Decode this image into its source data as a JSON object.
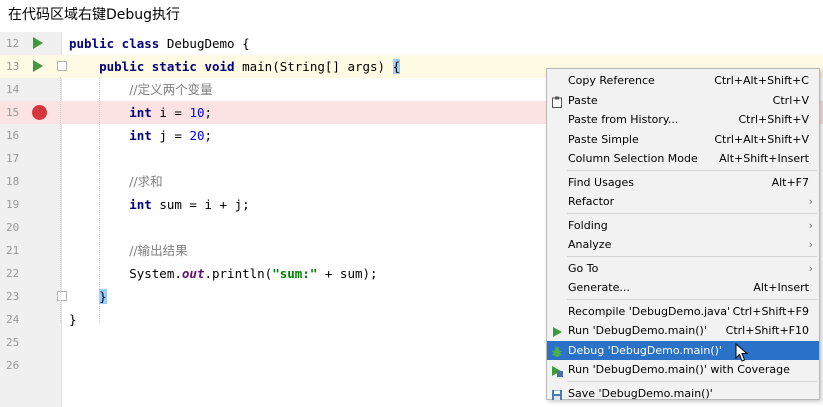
{
  "caption": "在代码区域右键Debug执行",
  "editor": {
    "lines": [
      {
        "num": "12",
        "code": [
          {
            "t": "public class ",
            "c": "kw"
          },
          {
            "t": "DebugDemo {",
            "c": ""
          }
        ]
      },
      {
        "num": "13",
        "code": [
          {
            "t": "    public static void ",
            "c": "kw"
          },
          {
            "t": "main(String[] args) ",
            "c": ""
          },
          {
            "t": "{",
            "c": "brace-hl"
          }
        ]
      },
      {
        "num": "14",
        "code": [
          {
            "t": "        ",
            "c": ""
          },
          {
            "t": "//定义两个变量",
            "c": "cmt"
          }
        ]
      },
      {
        "num": "15",
        "code": [
          {
            "t": "        ",
            "c": ""
          },
          {
            "t": "int ",
            "c": "kw"
          },
          {
            "t": "i = ",
            "c": ""
          },
          {
            "t": "10",
            "c": "num"
          },
          {
            "t": ";",
            "c": ""
          }
        ]
      },
      {
        "num": "16",
        "code": [
          {
            "t": "        ",
            "c": ""
          },
          {
            "t": "int ",
            "c": "kw"
          },
          {
            "t": "j = ",
            "c": ""
          },
          {
            "t": "20",
            "c": "num"
          },
          {
            "t": ";",
            "c": ""
          }
        ]
      },
      {
        "num": "17",
        "code": []
      },
      {
        "num": "18",
        "code": [
          {
            "t": "        ",
            "c": ""
          },
          {
            "t": "//求和",
            "c": "cmt"
          }
        ]
      },
      {
        "num": "19",
        "code": [
          {
            "t": "        ",
            "c": ""
          },
          {
            "t": "int ",
            "c": "kw"
          },
          {
            "t": "sum = i + j;",
            "c": ""
          }
        ]
      },
      {
        "num": "20",
        "code": []
      },
      {
        "num": "21",
        "code": [
          {
            "t": "        ",
            "c": ""
          },
          {
            "t": "//输出结果",
            "c": "cmt"
          }
        ]
      },
      {
        "num": "22",
        "code": [
          {
            "t": "        System.",
            "c": ""
          },
          {
            "t": "out",
            "c": "stat"
          },
          {
            "t": ".println(",
            "c": ""
          },
          {
            "t": "\"sum:\"",
            "c": "str"
          },
          {
            "t": " + sum);",
            "c": ""
          }
        ]
      },
      {
        "num": "23",
        "code": [
          {
            "t": "    ",
            "c": ""
          },
          {
            "t": "}",
            "c": "brace-hl"
          }
        ]
      },
      {
        "num": "24",
        "code": [
          {
            "t": "}",
            "c": ""
          }
        ]
      },
      {
        "num": "25",
        "code": []
      },
      {
        "num": "26",
        "code": []
      }
    ]
  },
  "menu": {
    "items": [
      {
        "label": "Copy Reference",
        "shortcut": "Ctrl+Alt+Shift+C"
      },
      {
        "label": "Paste",
        "shortcut": "Ctrl+V",
        "icon": "clipboard-icon"
      },
      {
        "label": "Paste from History...",
        "shortcut": "Ctrl+Shift+V"
      },
      {
        "label": "Paste Simple",
        "shortcut": "Ctrl+Alt+Shift+V"
      },
      {
        "label": "Column Selection Mode",
        "shortcut": "Alt+Shift+Insert"
      },
      {
        "label": "Find Usages",
        "shortcut": "Alt+F7"
      },
      {
        "label": "Refactor",
        "submenu": true
      },
      {
        "label": "Folding",
        "submenu": true
      },
      {
        "label": "Analyze",
        "submenu": true
      },
      {
        "label": "Go To",
        "submenu": true
      },
      {
        "label": "Generate...",
        "shortcut": "Alt+Insert"
      },
      {
        "label": "Recompile 'DebugDemo.java'",
        "shortcut": "Ctrl+Shift+F9"
      },
      {
        "label": "Run 'DebugDemo.main()'",
        "shortcut": "Ctrl+Shift+F10",
        "icon": "run-icon"
      },
      {
        "label": "Debug 'DebugDemo.main()'",
        "shortcut": "",
        "icon": "debug-icon",
        "selected": true
      },
      {
        "label": "Run 'DebugDemo.main()' with Coverage",
        "shortcut": "",
        "icon": "coverage-icon"
      },
      {
        "label": "Save 'DebugDemo.main()'",
        "shortcut": "",
        "icon": "save-icon"
      }
    ]
  },
  "colors": {
    "selection": "#2a72c8",
    "breakpoint": "#d6353b",
    "run": "#3d9a3d"
  }
}
